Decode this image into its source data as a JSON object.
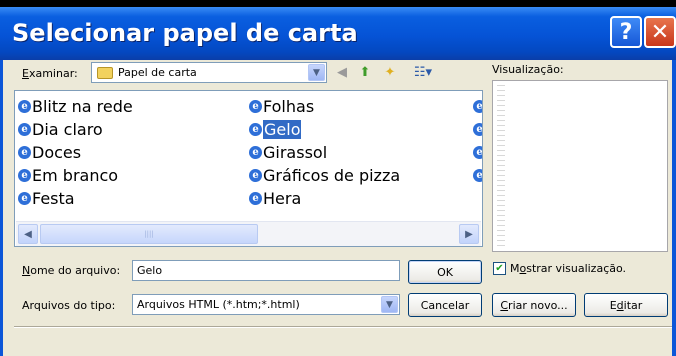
{
  "window": {
    "title": "Selecionar papel de carta",
    "help_glyph": "?",
    "close_glyph": "✕"
  },
  "lookin": {
    "label_u": "E",
    "label_rest": "xaminar:",
    "value": "Papel de carta"
  },
  "toolbar": {
    "back": "◀",
    "up": "⬆",
    "new_folder": "✦",
    "views": "☷▾"
  },
  "files": {
    "column1": [
      "Blitz na rede",
      "Dia claro",
      "Doces",
      "Em branco",
      "Festa"
    ],
    "column2": [
      "Folhas",
      "Gelo",
      "Girassol",
      "Gráficos de pizza",
      "Hera"
    ],
    "selected": "Gelo",
    "icon_glyph": "e"
  },
  "scroll": {
    "left": "◀",
    "right": "▶",
    "grip": "||||"
  },
  "preview": {
    "label": "Visualização:"
  },
  "filename": {
    "label_u": "N",
    "label_rest": "ome do arquivo:",
    "value": "Gelo"
  },
  "filetype": {
    "label": "Arquivos do tipo:",
    "value": "Arquivos HTML (*.htm;*.html)"
  },
  "buttons": {
    "ok": "OK",
    "cancel": "Cancelar",
    "create_u": "C",
    "create_rest": "riar novo...",
    "edit_pre": "E",
    "edit_u": "d",
    "edit_rest": "itar"
  },
  "show_preview": {
    "label_pre": "M",
    "label_u": "o",
    "label_rest": "strar visualização.",
    "checked_glyph": "✔"
  }
}
